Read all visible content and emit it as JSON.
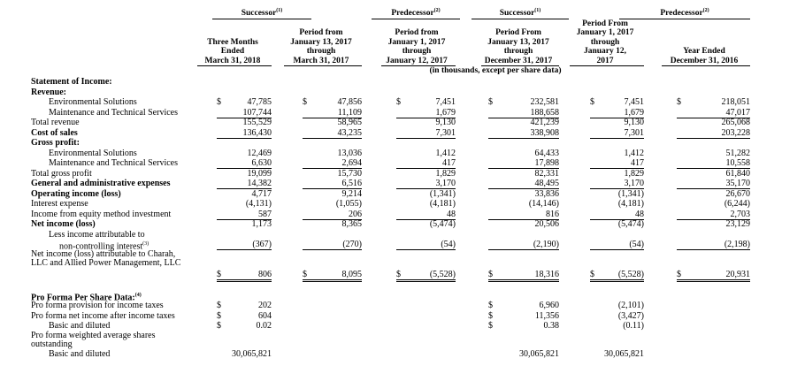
{
  "groups": [
    {
      "label": "Successor",
      "note": "(1)"
    },
    {
      "label": "Predecessor",
      "note": "(2)"
    },
    {
      "label": "Successor",
      "note": "(1)"
    },
    {
      "label": "Predecessor",
      "note": "(2)"
    }
  ],
  "columns": [
    "Three Months\nEnded\nMarch 31, 2018",
    "Period from\nJanuary 13, 2017\nthrough\nMarch 31, 2017",
    "Period from\nJanuary 1, 2017\nthrough\nJanuary 12, 2017",
    "Period From\nJanuary 13, 2017\nthrough\nDecember 31, 2017",
    "Period From\nJanuary 1, 2017\nthrough\nJanuary 12,\n2017",
    "Year Ended\nDecember 31, 2016"
  ],
  "units_note": "(in thousands, except per share data)",
  "currency_symbol": "$",
  "rows": [
    {
      "label": "Statement of Income:",
      "bold": true
    },
    {
      "label": "Revenue:",
      "bold": true
    },
    {
      "label": "Environmental Solutions",
      "indent": 2,
      "dollar": [
        1,
        1,
        1,
        1,
        1,
        1
      ],
      "values": [
        "47,785",
        "47,856",
        "7,451",
        "232,581",
        "7,451",
        "218,051"
      ]
    },
    {
      "label": "Maintenance and Technical Services",
      "indent": 2,
      "values": [
        "107,744",
        "11,109",
        "1,679",
        "188,658",
        "1,679",
        "47,017"
      ],
      "rule": true
    },
    {
      "label": "Total revenue",
      "values": [
        "155,529",
        "58,965",
        "9,130",
        "421,239",
        "9,130",
        "265,068"
      ]
    },
    {
      "label": "Cost of sales",
      "bold": true,
      "values": [
        "136,430",
        "43,235",
        "7,301",
        "338,908",
        "7,301",
        "203,228"
      ],
      "rule": true
    },
    {
      "label": "Gross profit:",
      "bold": true
    },
    {
      "label": "Environmental Solutions",
      "indent": 2,
      "values": [
        "12,469",
        "13,036",
        "1,412",
        "64,433",
        "1,412",
        "51,282"
      ]
    },
    {
      "label": "Maintenance and Technical Services",
      "indent": 2,
      "values": [
        "6,630",
        "2,694",
        "417",
        "17,898",
        "417",
        "10,558"
      ],
      "rule": true
    },
    {
      "label": "Total gross profit",
      "values": [
        "19,099",
        "15,730",
        "1,829",
        "82,331",
        "1,829",
        "61,840"
      ]
    },
    {
      "label": "General and administrative expenses",
      "bold": true,
      "values": [
        "14,382",
        "6,516",
        "3,170",
        "48,495",
        "3,170",
        "35,170"
      ],
      "rule": true
    },
    {
      "label": "Operating income (loss)",
      "bold": true,
      "values": [
        "4,717",
        "9,214",
        "(1,341)",
        "33,836",
        "(1,341)",
        "26,670"
      ]
    },
    {
      "label": "Interest expense",
      "values": [
        "(4,131)",
        "(1,055)",
        "(4,181)",
        "(14,146)",
        "(4,181)",
        "(6,244)"
      ]
    },
    {
      "label": "Income from equity method investment",
      "values": [
        "587",
        "206",
        "48",
        "816",
        "48",
        "2,703"
      ],
      "rule": true
    },
    {
      "label": "Net income (loss)",
      "bold": true,
      "values": [
        "1,173",
        "8,365",
        "(5,474)",
        "20,506",
        "(5,474)",
        "23,129"
      ]
    },
    {
      "label": "Less income attributable to",
      "indent": 2
    },
    {
      "label": "non-controlling interest",
      "note": "(3)",
      "indent": 3,
      "values": [
        "(367)",
        "(270)",
        "(54)",
        "(2,190)",
        "(54)",
        "(2,198)"
      ],
      "rule": true
    },
    {
      "label": "Net income (loss) attributable to Charah, LLC and Allied Power Management, LLC",
      "wrap": true,
      "dollar": [
        1,
        1,
        1,
        1,
        1,
        1
      ],
      "values": [
        "806",
        "8,095",
        "(5,528)",
        "18,316",
        "(5,528)",
        "20,931"
      ],
      "rule": true,
      "double": true
    },
    {
      "label": "",
      "spacer": true
    },
    {
      "label": "Pro Forma Per Share Data:",
      "note": "(4)",
      "bold": true
    },
    {
      "label": "Pro forma provision for income taxes",
      "dollar": [
        1,
        0,
        0,
        1,
        0,
        0
      ],
      "values": [
        "202",
        "",
        "",
        "6,960",
        "(2,101)",
        ""
      ]
    },
    {
      "label": "Pro forma net income after income taxes",
      "dollar": [
        1,
        0,
        0,
        1,
        0,
        0
      ],
      "values": [
        "604",
        "",
        "",
        "11,356",
        "(3,427)",
        ""
      ]
    },
    {
      "label": "Basic and diluted",
      "indent": 2,
      "dollar": [
        1,
        0,
        0,
        1,
        0,
        0
      ],
      "values": [
        "0.02",
        "",
        "",
        "0.38",
        "(0.11)",
        ""
      ]
    },
    {
      "label": "Pro forma weighted average shares outstanding",
      "wrap": true
    },
    {
      "label": "Basic and diluted",
      "indent": 2,
      "values": [
        "30,065,821",
        "",
        "",
        "30,065,821",
        "30,065,821",
        ""
      ]
    }
  ]
}
